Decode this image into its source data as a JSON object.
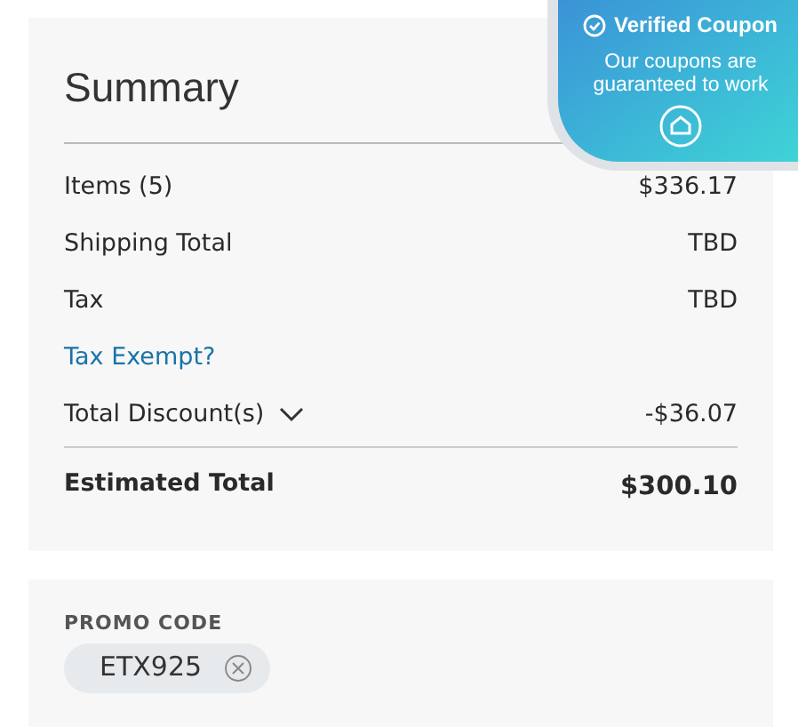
{
  "summary": {
    "title": "Summary",
    "rows": [
      {
        "kind": "line",
        "label": "Items (5)",
        "value": "$336.17"
      },
      {
        "kind": "line",
        "label": "Shipping Total",
        "value": "TBD"
      },
      {
        "kind": "line",
        "label": "Tax",
        "value": "TBD"
      },
      {
        "kind": "link",
        "label": "Tax Exempt?"
      },
      {
        "kind": "dropdown",
        "label": "Total Discount(s)",
        "value": "-$36.07",
        "expanded": false
      }
    ],
    "total": {
      "label": "Estimated Total",
      "value": "$300.10"
    }
  },
  "promo": {
    "heading": "PROMO CODE",
    "code": "ETX925"
  },
  "coupon_badge": {
    "title": "Verified Coupon",
    "text": "Our coupons are guaranteed to work"
  }
}
